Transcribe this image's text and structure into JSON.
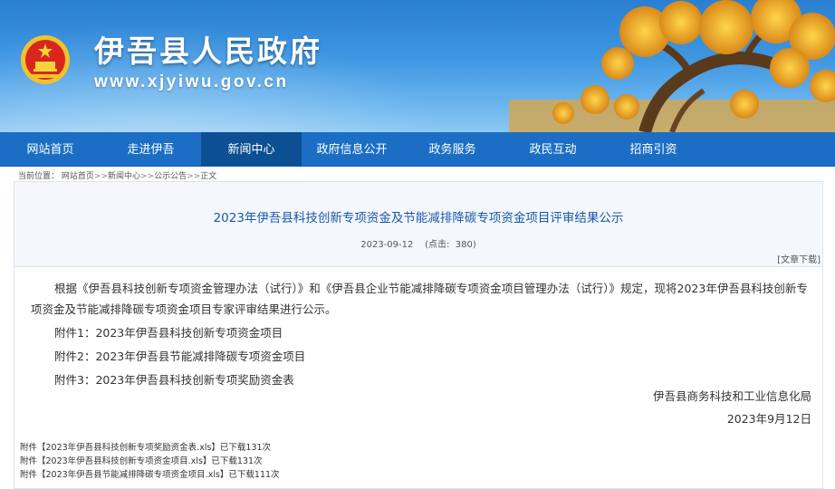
{
  "header": {
    "site_title": "伊吾县人民政府",
    "site_url": "www.xjyiwu.gov.cn"
  },
  "nav": {
    "items": [
      "网站首页",
      "走进伊吾",
      "新闻中心",
      "政府信息公开",
      "政务服务",
      "政民互动",
      "招商引资"
    ],
    "active": "新闻中心"
  },
  "breadcrumb": {
    "label": "当前位置：",
    "path": [
      "网站首页",
      "新闻中心",
      "公示公告",
      "正文"
    ],
    "separator": ">>"
  },
  "article": {
    "title": "2023年伊吾县科技创新专项资金及节能减排降碳专项资金项目评审结果公示",
    "date": "2023-09-12",
    "clicks_label": "(点击:",
    "clicks": "380)",
    "print_label": "[文章下载]",
    "paragraph": "根据《伊吾县科技创新专项资金管理办法（试行）》和《伊吾县企业节能减排降碳专项资金项目管理办法（试行）》规定，现将2023年伊吾县科技创新专项资金及节能减排降碳专项资金项目专家评审结果进行公示。",
    "attachments_text": [
      "附件1：2023年伊吾县科技创新专项资金项目",
      "附件2：2023年伊吾县节能减排降碳专项资金项目",
      "附件3：2023年伊吾县科技创新专项奖励资金表"
    ],
    "signature": "伊吾县商务科技和工业信息化局",
    "sign_date": "2023年9月12日",
    "files": [
      "附件【2023年伊吾县科技创新专项奖励资金表.xls】已下载131次",
      "附件【2023年伊吾县科技创新专项资金项目.xls】已下载131次",
      "附件【2023年伊吾县节能减排降碳专项资金项目.xls】已下载111次"
    ]
  },
  "colors": {
    "nav_bg": "#1b6ec4",
    "nav_active": "#0d4f93",
    "title_blue": "#1a58a8"
  }
}
